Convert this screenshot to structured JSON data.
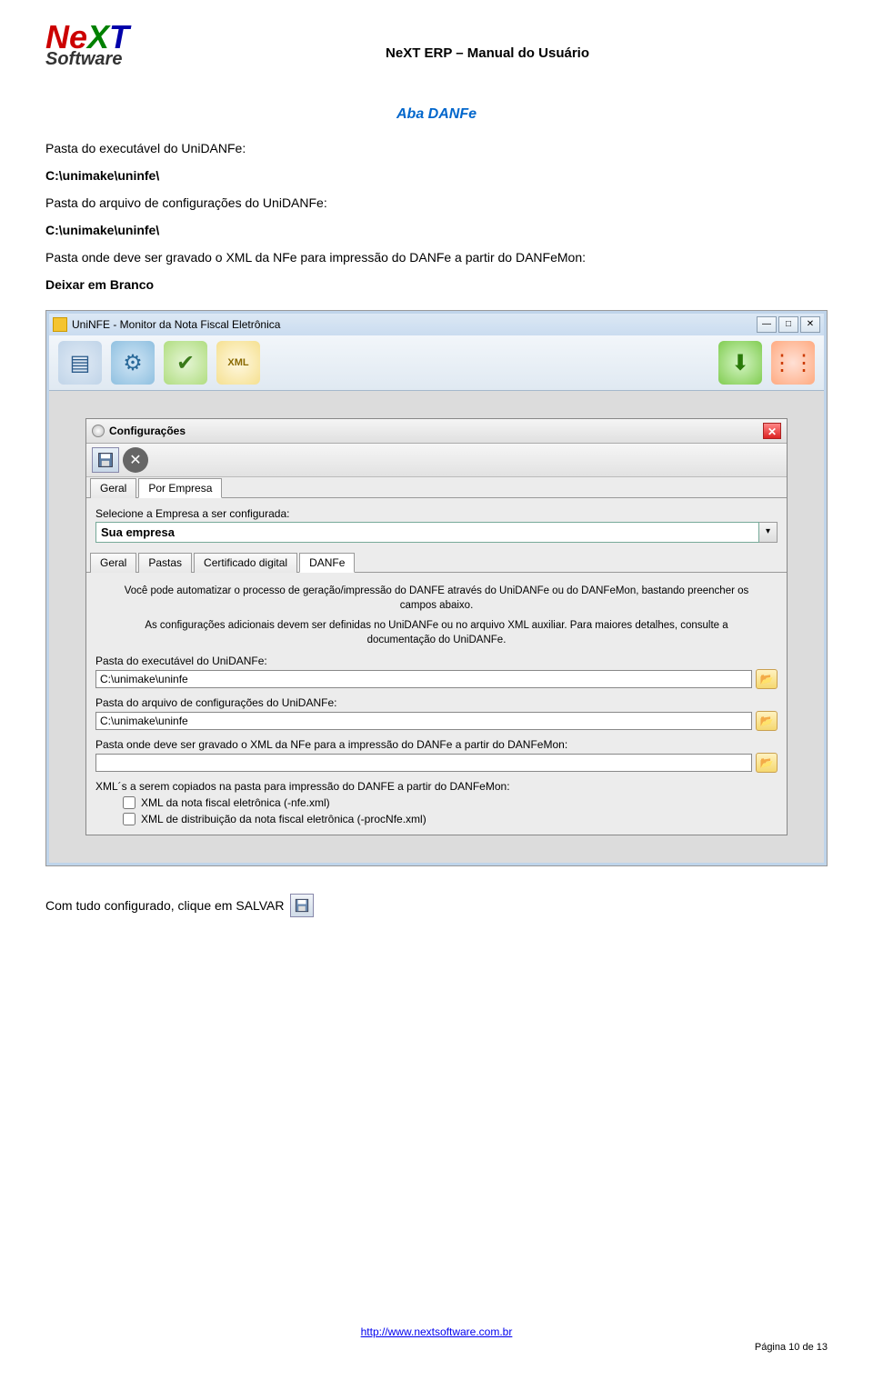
{
  "header": {
    "doc_title": "NeXT ERP – Manual do Usuário"
  },
  "section": {
    "title": "Aba DANFe",
    "p1": "Pasta do executável do UniDANFe:",
    "p1v": "C:\\unimake\\uninfe\\",
    "p2": "Pasta do arquivo de configurações do UniDANFe:",
    "p2v": "C:\\unimake\\uninfe\\",
    "p3": "Pasta onde deve ser gravado o XML da NFe para impressão do DANFe a partir do DANFeMon:",
    "p3v": "Deixar em Branco"
  },
  "app": {
    "title": "UniNFE - Monitor da Nota Fiscal Eletrônica",
    "xml_label": "XML",
    "config_window": {
      "title": "Configurações",
      "tab_geral": "Geral",
      "tab_por_empresa": "Por Empresa",
      "select_label": "Selecione a Empresa a ser configurada:",
      "company": "Sua empresa",
      "subtab_geral": "Geral",
      "subtab_pastas": "Pastas",
      "subtab_cert": "Certificado digital",
      "subtab_danfe": "DANFe",
      "info1": "Você pode automatizar o processo de geração/impressão do DANFE através do UniDANFe ou do DANFeMon, bastando preencher os campos abaixo.",
      "info2": "As configurações adicionais devem ser definidas no UniDANFe ou no arquivo XML auxiliar. Para maiores detalhes, consulte a documentação do UniDANFe.",
      "f1_label": "Pasta do executável do UniDANFe:",
      "f1_value": "C:\\unimake\\uninfe",
      "f2_label": "Pasta do arquivo de configurações do UniDANFe:",
      "f2_value": "C:\\unimake\\uninfe",
      "f3_label": "Pasta onde deve ser gravado o XML da NFe para a impressão do DANFe a partir do DANFeMon:",
      "f3_value": "",
      "chk_label": "XML´s a serem copiados na pasta para impressão do DANFE a partir do DANFeMon:",
      "chk1": "XML da nota fiscal eletrônica (-nfe.xml)",
      "chk2": "XML de distribuição da nota fiscal eletrônica (-procNfe.xml)"
    }
  },
  "after": {
    "text": "Com tudo configurado, clique em SALVAR"
  },
  "footer": {
    "url": "http://www.nextsoftware.com.br",
    "page": "Página 10 de 13"
  }
}
